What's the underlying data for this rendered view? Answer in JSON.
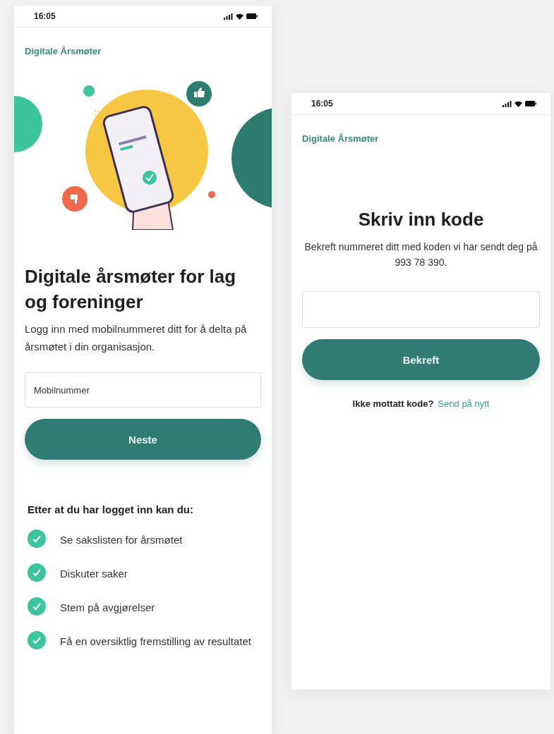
{
  "login_screen": {
    "status_bar": {
      "time": "16:05"
    },
    "brand": "Digitale Årsmøter",
    "heading": "Digitale årsmøter for lag og foreninger",
    "intro": "Logg inn med mobilnummeret ditt for å delta på årsmøtet i din organisasjon.",
    "phone_field": {
      "placeholder": "Mobilnummer"
    },
    "button": "Neste",
    "benefits": {
      "title": "Etter at du har logget inn kan du:",
      "items": [
        {
          "text": "Se sakslisten for årsmøtet"
        },
        {
          "text": "Diskuter saker"
        },
        {
          "text": "Stem på avgjørelser"
        },
        {
          "text": "Få en oversiktlig fremstilling av resultatet"
        }
      ]
    }
  },
  "code_screen": {
    "status_bar": {
      "time": "16:05"
    },
    "brand": "Digitale Årsmøter",
    "heading": "Skriv inn kode",
    "intro": "Bekreft nummeret ditt med koden vi har sendt deg på 993 78 390.",
    "button": "Bekreft",
    "resend_prompt": "Ikke mottatt kode?",
    "resend_link": "Send på nytt"
  }
}
